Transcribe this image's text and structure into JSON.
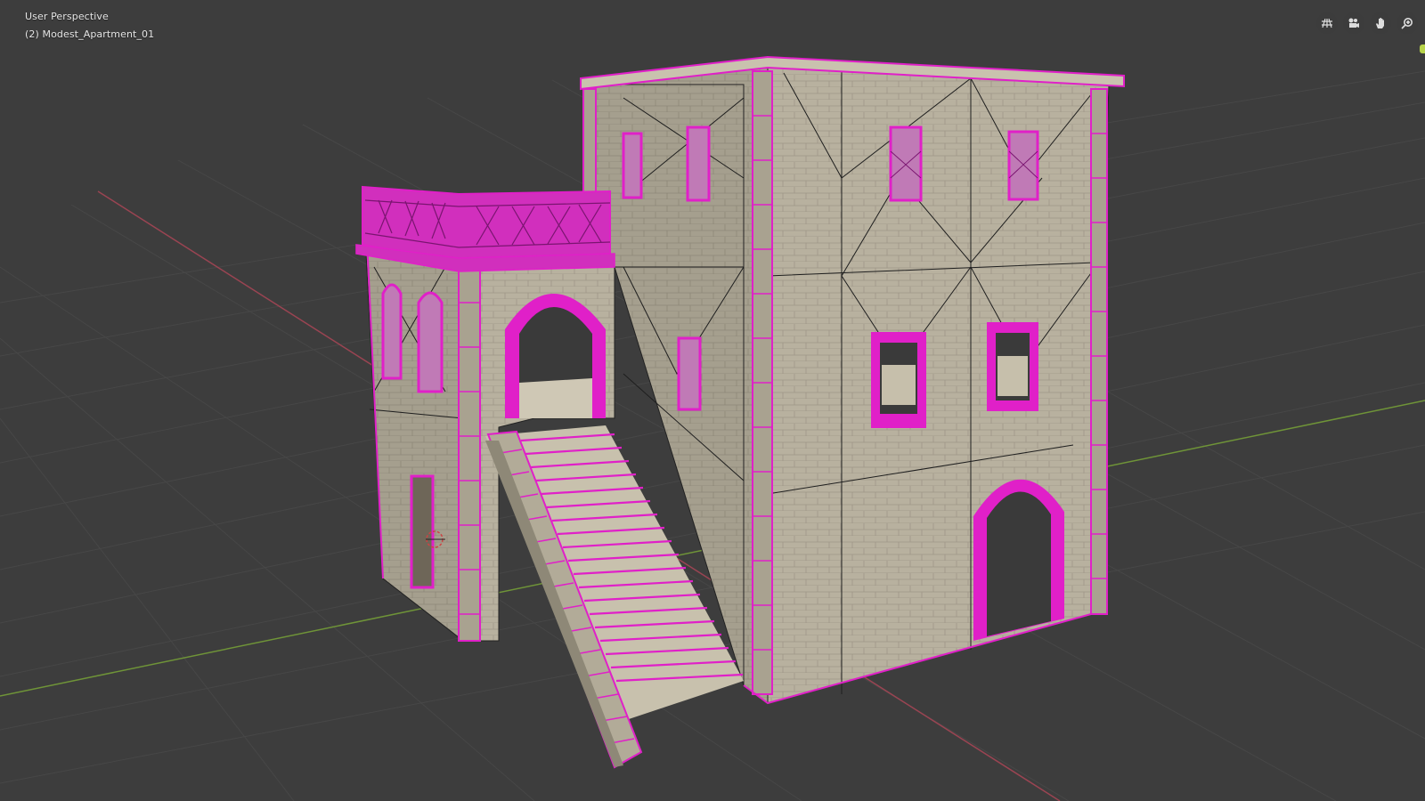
{
  "viewport": {
    "view_name": "User Perspective",
    "object_name": "(2) Modest_Apartment_01"
  },
  "navigation": {
    "buttons": [
      {
        "name": "ortho-toggle",
        "icon": "grid-icon"
      },
      {
        "name": "camera-view",
        "icon": "camera-icon"
      },
      {
        "name": "pan-view",
        "icon": "hand-icon"
      },
      {
        "name": "zoom-view",
        "icon": "zoom-icon"
      }
    ]
  },
  "colors": {
    "background": "#3d3d3d",
    "grid": "#4a4a4a",
    "x_axis": "#b44a5a",
    "y_axis": "#7aa33d",
    "selection": "#e020c8",
    "stone": "#b9b29f",
    "stone_dark": "#8f8979"
  }
}
